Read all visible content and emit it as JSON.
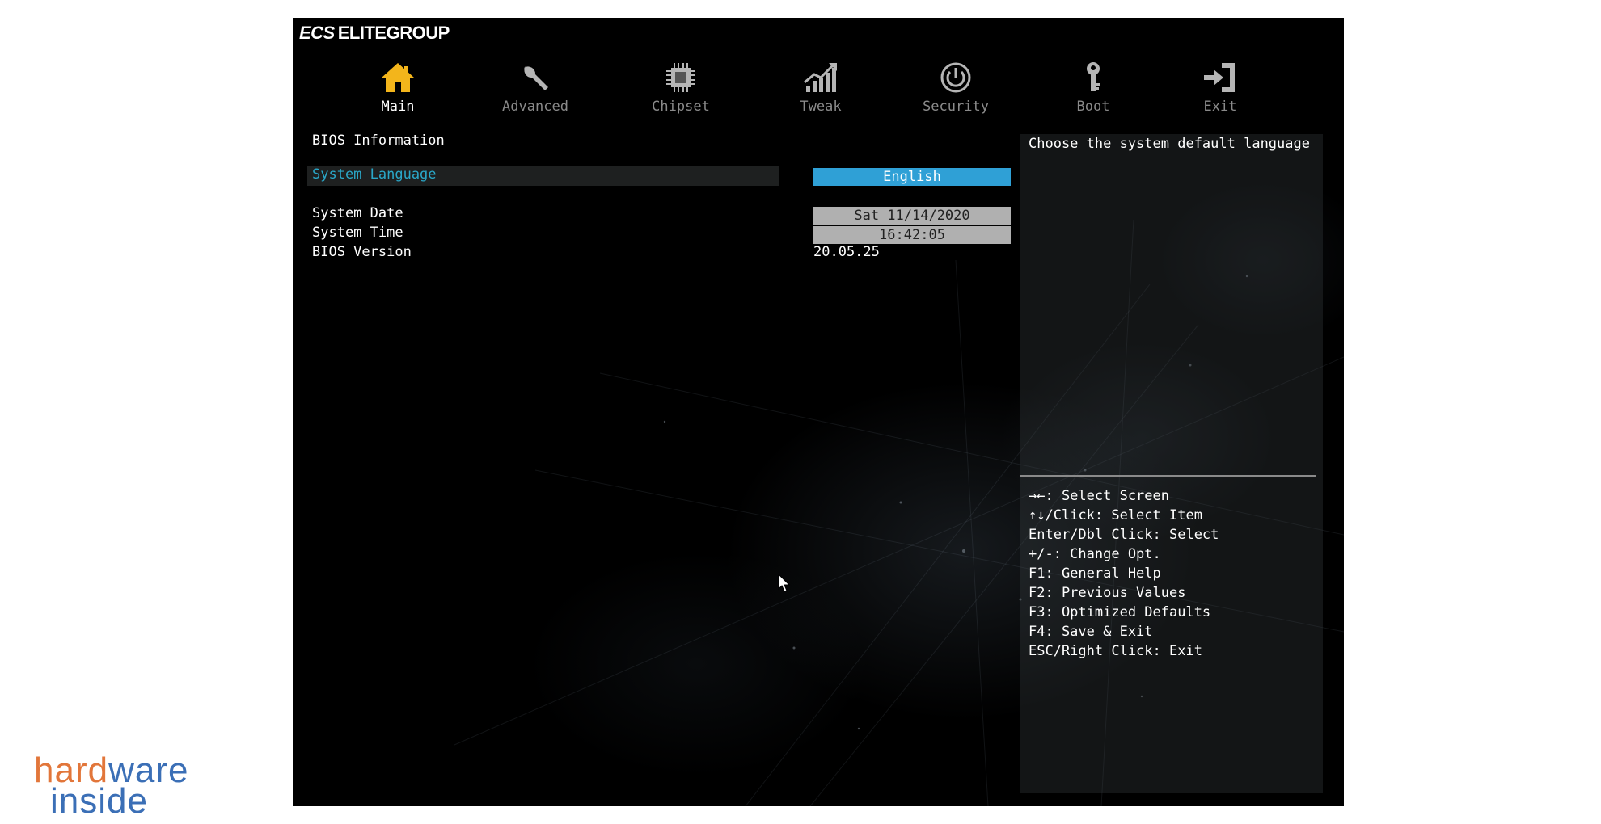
{
  "brand": {
    "name": "ELITEGROUP",
    "mark": "ECS"
  },
  "tabs": [
    {
      "label": "Main",
      "icon": "home-icon",
      "active": true
    },
    {
      "label": "Advanced",
      "icon": "wrench-icon",
      "active": false
    },
    {
      "label": "Chipset",
      "icon": "chip-icon",
      "active": false
    },
    {
      "label": "Tweak",
      "icon": "chart-icon",
      "active": false
    },
    {
      "label": "Security",
      "icon": "power-icon",
      "active": false
    },
    {
      "label": "Boot",
      "icon": "key-icon",
      "active": false
    },
    {
      "label": "Exit",
      "icon": "exit-icon",
      "active": false
    }
  ],
  "main": {
    "section_title": "BIOS Information",
    "system_language": {
      "label": "System Language",
      "value": "English"
    },
    "system_date": {
      "label": "System Date",
      "value": "Sat 11/14/2020"
    },
    "system_time": {
      "label": "System Time",
      "value": "16:42:05"
    },
    "bios_version": {
      "label": "BIOS Version",
      "value": "20.05.25"
    }
  },
  "help": {
    "description": "Choose the system default language",
    "keys": [
      "→←: Select Screen",
      "↑↓/Click: Select Item",
      "Enter/Dbl Click: Select",
      "+/-: Change Opt.",
      "F1: General Help",
      "F2: Previous Values",
      "F3: Optimized Defaults",
      "F4: Save & Exit",
      "ESC/Right Click: Exit"
    ]
  },
  "colors": {
    "accent": "#2fa0d6",
    "highlight_label": "#2aa7c8",
    "active_icon": "#f3b51b",
    "inactive_icon": "#b5b5b5",
    "value_box": "#b0b0b0"
  },
  "watermark": {
    "line1": "hardware",
    "line2": "inside"
  }
}
